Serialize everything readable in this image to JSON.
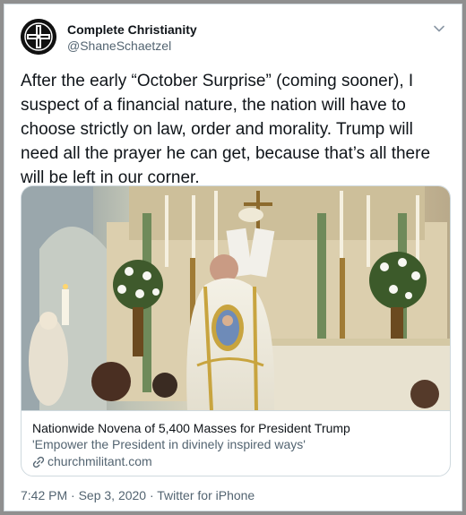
{
  "author": {
    "display_name": "Complete Christianity",
    "handle": "@ShaneSchaetzel"
  },
  "tweet": {
    "text": "After the early “October Surprise” (coming sooner), I suspect of a financial nature, the nation will have to choose strictly on law, order and morality. Trump will need all the prayer he can get, because that’s all there will be left in our corner."
  },
  "card": {
    "title": "Nationwide Novena of 5,400 Masses for President Trump",
    "description": "'Empower the President in divinely inspired ways'",
    "domain": "churchmilitant.com"
  },
  "footer": {
    "meta": "7:42 PM · Sep 3, 2020 · Twitter for iPhone"
  },
  "icons": {
    "avatar": "cross-logo-icon",
    "menu": "chevron-down-icon",
    "link": "link-icon"
  },
  "colors": {
    "primary_text": "#0f1419",
    "secondary_text": "#536471",
    "border": "#cfd9de"
  }
}
